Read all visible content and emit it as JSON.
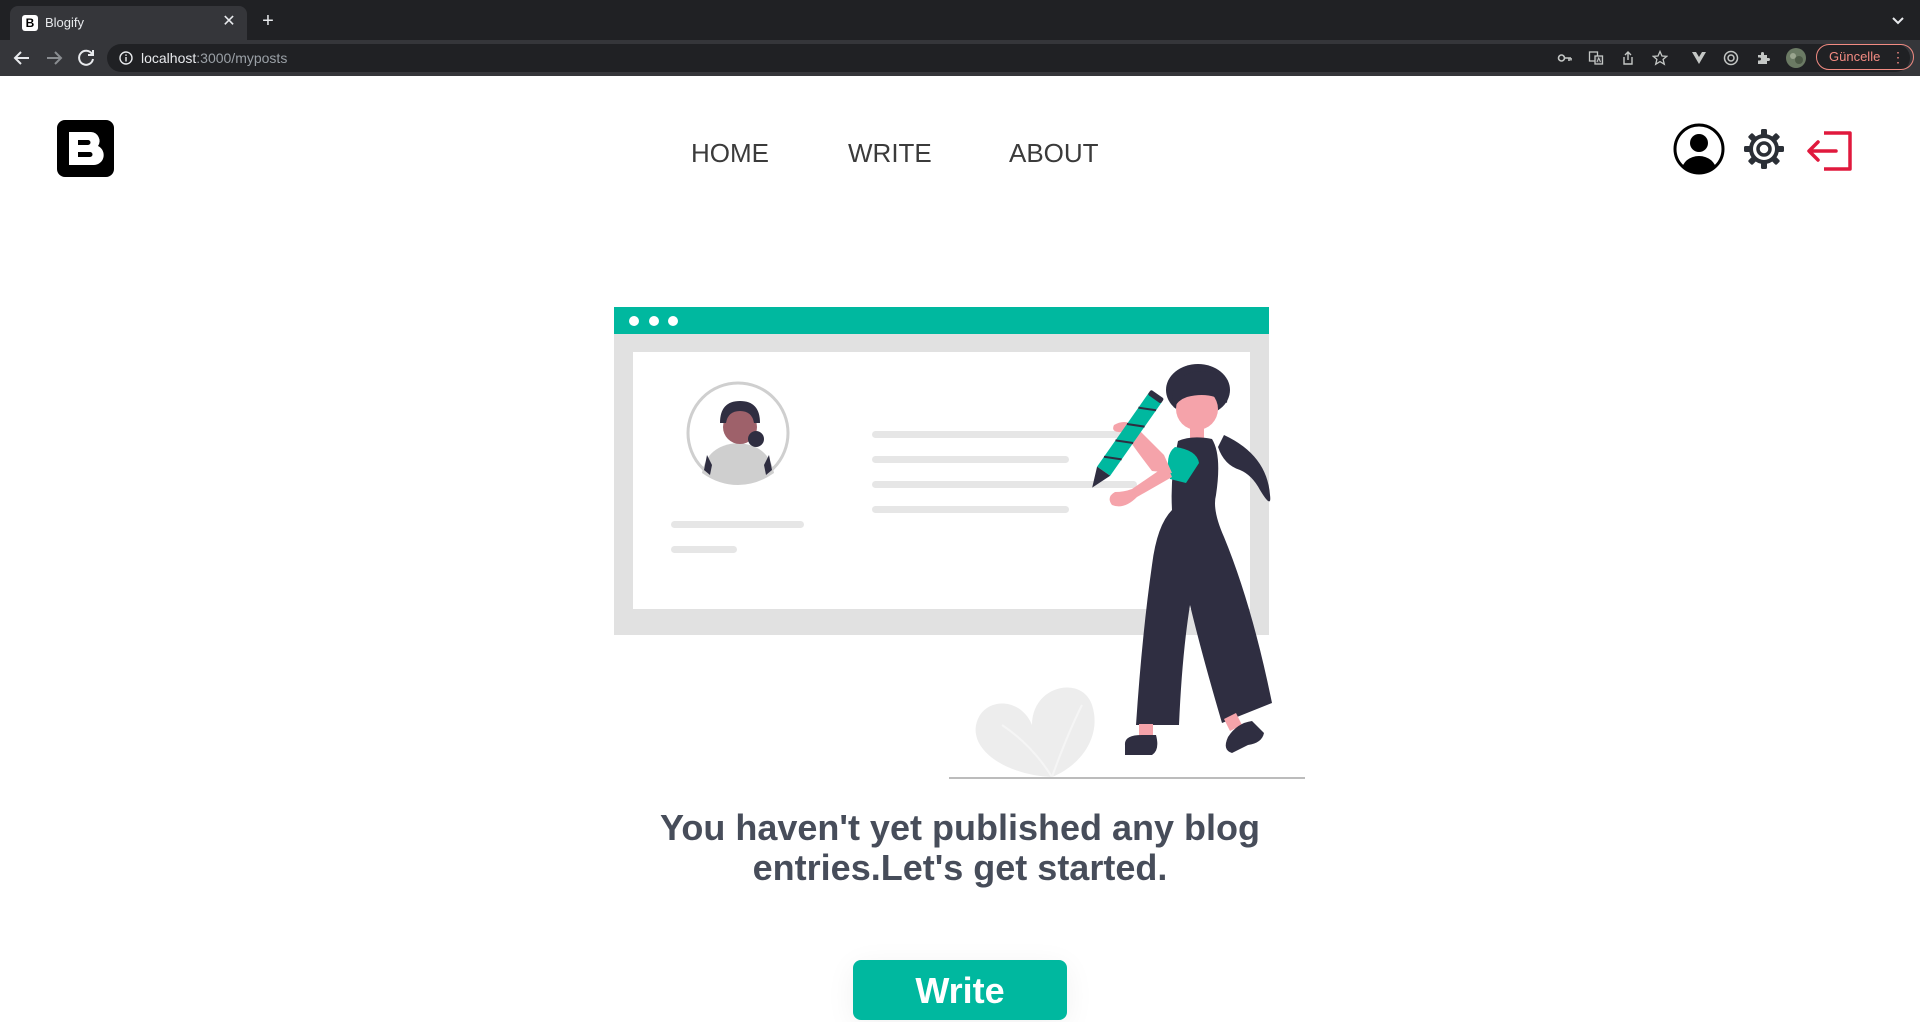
{
  "browser": {
    "tab_title": "Blogify",
    "tab_favicon": "B",
    "url_host": "localhost",
    "url_path": ":3000/myposts",
    "update_label": "Güncelle"
  },
  "site": {
    "nav": [
      {
        "label": "HOME"
      },
      {
        "label": "WRITE"
      },
      {
        "label": "ABOUT"
      }
    ],
    "colors": {
      "accent": "#00b89f",
      "logout": "#e0193d",
      "text": "#474d5a"
    }
  },
  "empty_state": {
    "line1": "You haven't yet published any blog",
    "line2": "entries.Let's get started.",
    "button_label": "Write"
  }
}
